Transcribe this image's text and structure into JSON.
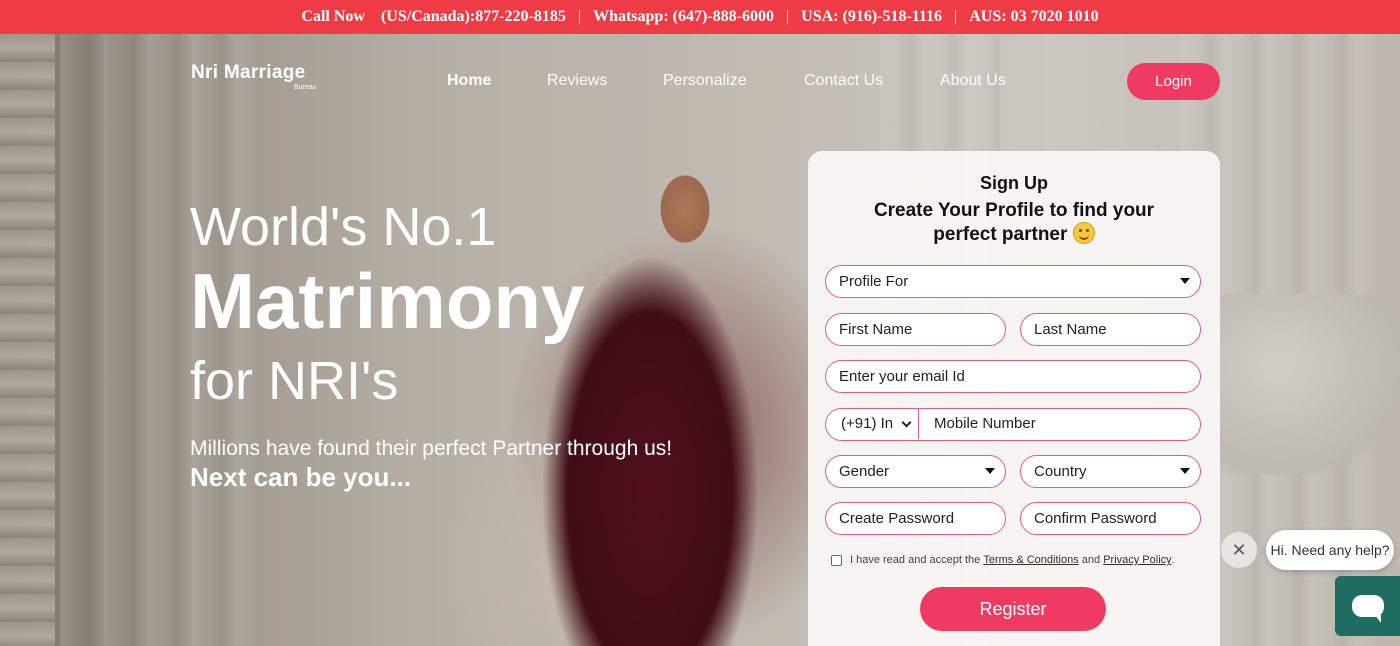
{
  "topbar": {
    "call_now": "Call Now",
    "us_canada": "(US/Canada):877-220-8185",
    "whatsapp": "Whatsapp: (647)-888-6000",
    "usa": "USA: (916)-518-1116",
    "aus": "AUS: 03 7020 1010",
    "separator": "|"
  },
  "brand": {
    "name": "Nri Marriage",
    "sub": "Bureau"
  },
  "nav": {
    "items": [
      {
        "label": "Home",
        "active": true
      },
      {
        "label": "Reviews"
      },
      {
        "label": "Personalize"
      },
      {
        "label": "Contact Us"
      },
      {
        "label": "About Us"
      }
    ],
    "login": "Login"
  },
  "hero": {
    "line1": "World's No.1",
    "line2": "Matrimony",
    "line3": "for NRI's",
    "tagline1": "Millions have found their perfect Partner through us!",
    "tagline2": "Next can be you..."
  },
  "signup": {
    "title": "Sign Up",
    "subtitle": "Create Your Profile to find your perfect partner",
    "profile_for": "Profile For",
    "first_name": "First Name",
    "last_name": "Last Name",
    "email": "Enter your email Id",
    "country_code": "(+91) In",
    "mobile": "Mobile Number",
    "gender": "Gender",
    "country": "Country",
    "create_password": "Create Password",
    "confirm_password": "Confirm Password",
    "consent_prefix": "I have read and accept the",
    "terms": "Terms & Conditions",
    "and": "and",
    "privacy": "Privacy Policy",
    "period": ".",
    "register": "Register"
  },
  "chat": {
    "bubble": "Hi. Need any help?",
    "close": "✕"
  },
  "colors": {
    "topbar": "#ef3b45",
    "accent": "#ef3b62",
    "field_border": "#e45a82",
    "chat": "#1f6c63"
  }
}
